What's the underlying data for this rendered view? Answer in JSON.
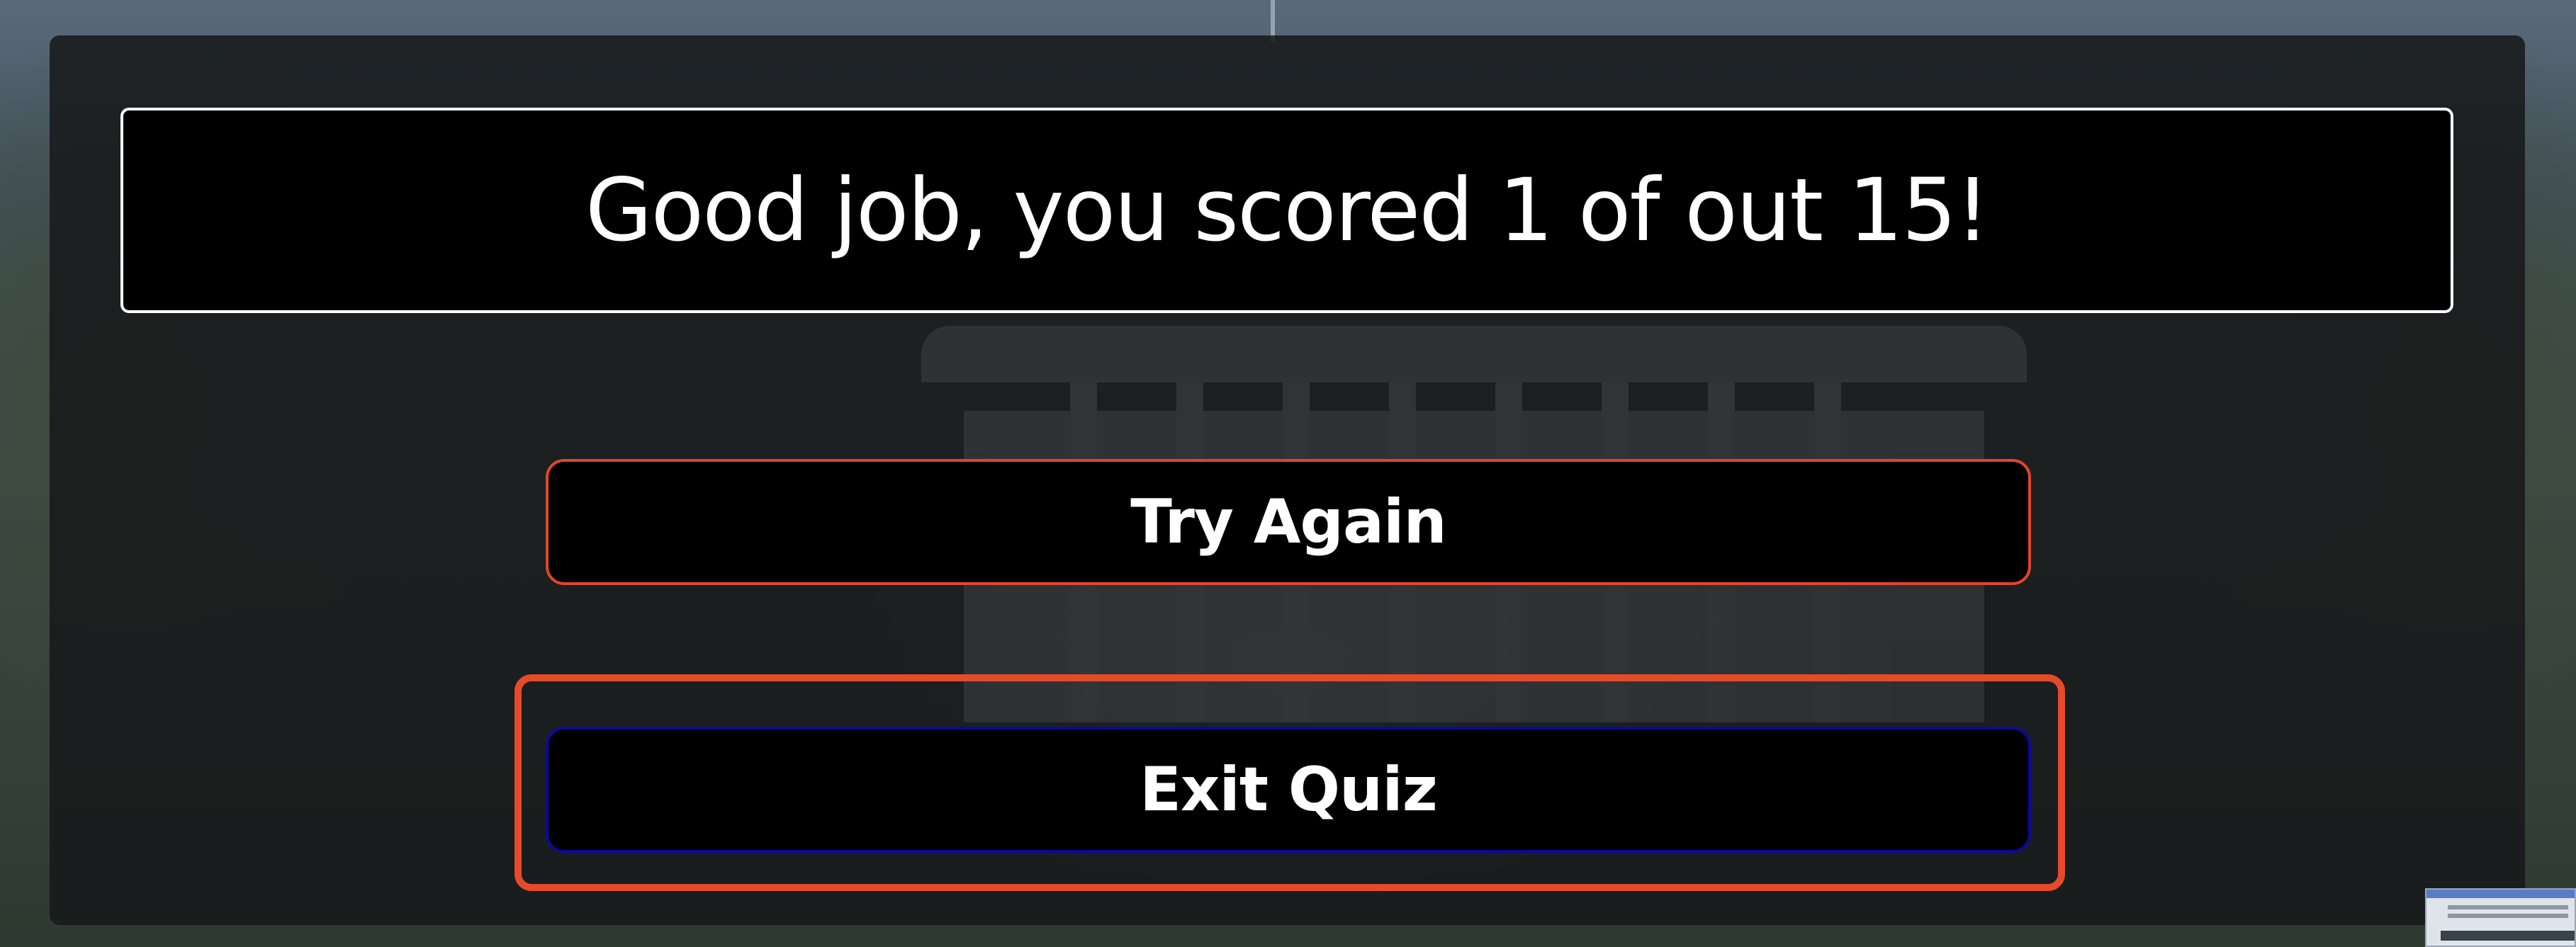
{
  "result": {
    "message": "Good job, you scored 1 of out 15!"
  },
  "actions": {
    "try_again_label": "Try Again",
    "exit_quiz_label": "Exit Quiz"
  },
  "colors": {
    "accent_border": "#e0452c",
    "focus_ring": "#e54a2a",
    "exit_border": "#0a0a9a",
    "panel": "#000000",
    "text": "#ffffff"
  }
}
